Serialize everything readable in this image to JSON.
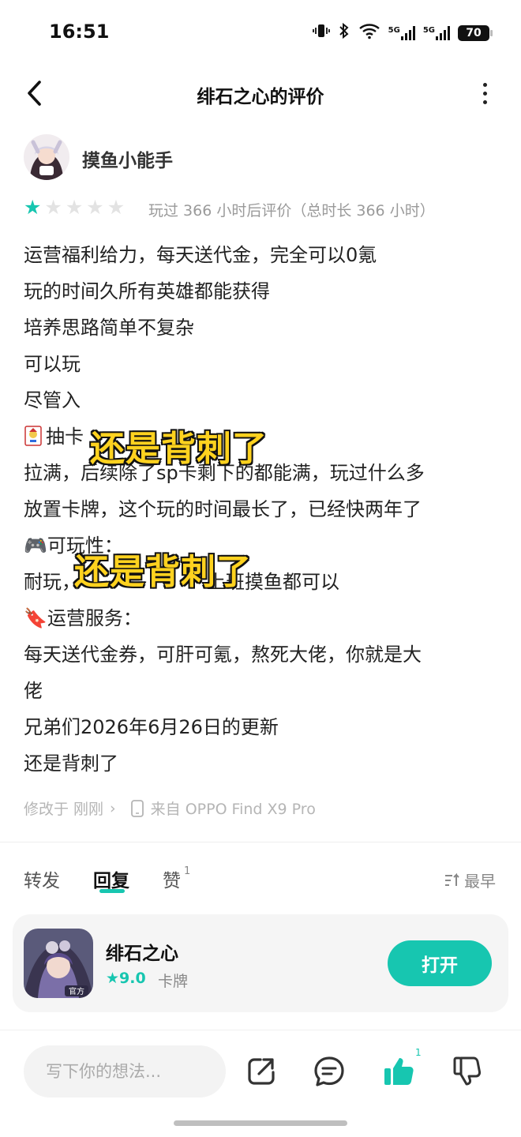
{
  "status_bar": {
    "time": "16:51",
    "network_label_1": "5G",
    "network_label_2": "5G",
    "battery": "70"
  },
  "header": {
    "title": "绯石之心的评价"
  },
  "review": {
    "username": "摸鱼小能手",
    "rating": 1,
    "rating_max": 5,
    "play_meta": "玩过 366 小时后评价（总时长 366 小时）",
    "lines": [
      "运营福利给力，每天送代金，完全可以0氪",
      "玩的时间久所有英雄都能获得",
      "培养思路简单不复杂",
      "可以玩",
      "尽管入",
      "抽卡",
      "拉满，后续除了sp卡剩下的都能满，玩过什么多",
      "放置卡牌，这个玩的时间最长了，已经快两年了",
      "🎮可玩性：",
      "耐玩，",
      "🔖运营服务：",
      "每天送代金券，可肝可氪，熬死大佬，你就是大",
      "佬",
      "兄弟们2026年6月26日的更新",
      "还是背刺了"
    ],
    "line9_tail": "上班摸鱼都可以",
    "overlay_text_1": "还是背刺了",
    "overlay_text_2": "还是背刺了",
    "modified": "修改于 刚刚",
    "device": "来自 OPPO Find X9 Pro"
  },
  "tabs": {
    "forward": "转发",
    "reply": "回复",
    "like": "赞",
    "like_count": "1",
    "sort": "最早"
  },
  "game": {
    "name": "绯石之心",
    "rating": "9.0",
    "genre": "卡牌",
    "open_label": "打开",
    "icon_badge": "官方"
  },
  "bottom_bar": {
    "input_placeholder": "写下你的想法...",
    "like_count": "1"
  },
  "colors": {
    "accent": "#17c6b0",
    "overlay_text": "#ffd21f"
  },
  "icons": [
    "vibrate-icon",
    "bluetooth-icon",
    "wifi-icon",
    "back-icon",
    "more-icon",
    "star-icon",
    "phone-icon",
    "sort-icon",
    "share-icon",
    "comment-icon",
    "thumbs-up-icon",
    "thumbs-down-icon"
  ]
}
